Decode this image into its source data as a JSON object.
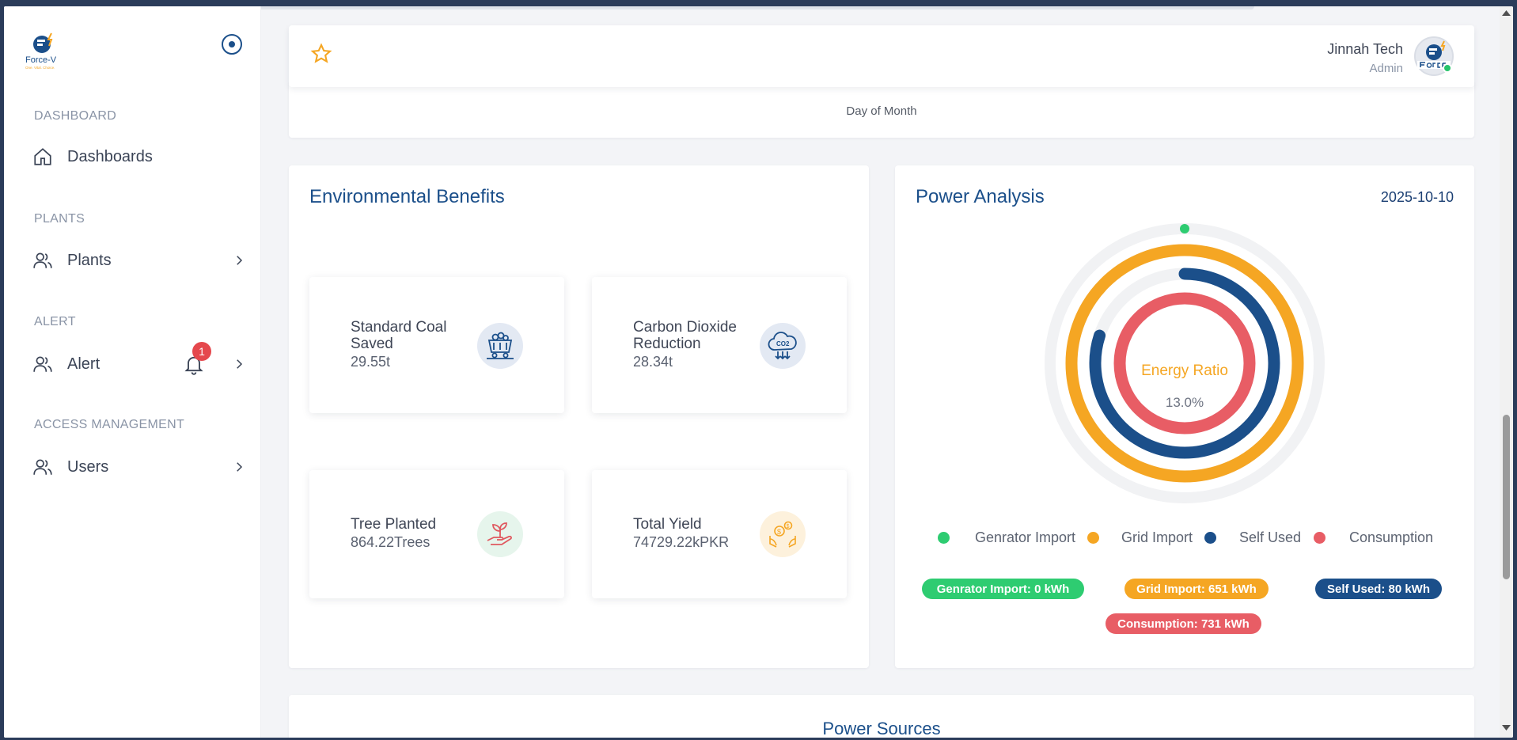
{
  "app": {
    "brand": "Force-V",
    "tagline": "One. Vital. Choice."
  },
  "sidebar": {
    "sections": [
      {
        "title": "DASHBOARD",
        "item": "Dashboards"
      },
      {
        "title": "PLANTS",
        "item": "Plants"
      },
      {
        "title": "ALERT",
        "item": "Alert",
        "badge": "1"
      },
      {
        "title": "ACCESS MANAGEMENT",
        "item": "Users"
      }
    ]
  },
  "header": {
    "user_name": "Jinnah Tech",
    "user_role": "Admin"
  },
  "chart_tail": {
    "xlabel": "Day of Month"
  },
  "environmental": {
    "title": "Environmental Benefits",
    "tiles": [
      {
        "label_line1": "Standard Coal",
        "label_line2": "Saved",
        "value": "29.55t",
        "icon": "coal-cart-icon"
      },
      {
        "label_line1": "Carbon Dioxide",
        "label_line2": "Reduction",
        "value": "28.34t",
        "icon": "co2-cloud-icon"
      },
      {
        "label_line1": "Tree Planted",
        "label_line2": "",
        "value": "864.22Trees",
        "icon": "plant-hand-icon"
      },
      {
        "label_line1": "Total Yield",
        "label_line2": "",
        "value": "74729.22kPKR",
        "icon": "money-hands-icon"
      }
    ]
  },
  "power": {
    "title": "Power Analysis",
    "date": "2025-10-10",
    "center_label": "Energy Ratio",
    "center_value": "13.0%",
    "legend": [
      {
        "label": "Genrator Import",
        "color": "#2ecc71"
      },
      {
        "label": "Grid Import",
        "color": "#f5a623"
      },
      {
        "label": "Self Used",
        "color": "#1b4f8a"
      },
      {
        "label": "Consumption",
        "color": "#e85d65"
      }
    ],
    "pills": [
      {
        "text": "Genrator Import: 0 kWh",
        "color": "#2ecc71"
      },
      {
        "text": "Grid Import: 651 kWh",
        "color": "#f5a623"
      },
      {
        "text": "Self Used: 80 kWh",
        "color": "#1b4f8a"
      },
      {
        "text": "Consumption: 731 kWh",
        "color": "#e85d65"
      }
    ],
    "chart_data": {
      "type": "radial-bar",
      "series": [
        {
          "name": "Genrator Import",
          "value_kwh": 0,
          "fraction": 0.0
        },
        {
          "name": "Grid Import",
          "value_kwh": 651,
          "fraction": 1.0
        },
        {
          "name": "Self Used",
          "value_kwh": 80,
          "fraction": 0.8
        },
        {
          "name": "Consumption",
          "value_kwh": 731,
          "fraction": 1.0
        }
      ]
    }
  },
  "sources": {
    "title": "Power Sources"
  }
}
